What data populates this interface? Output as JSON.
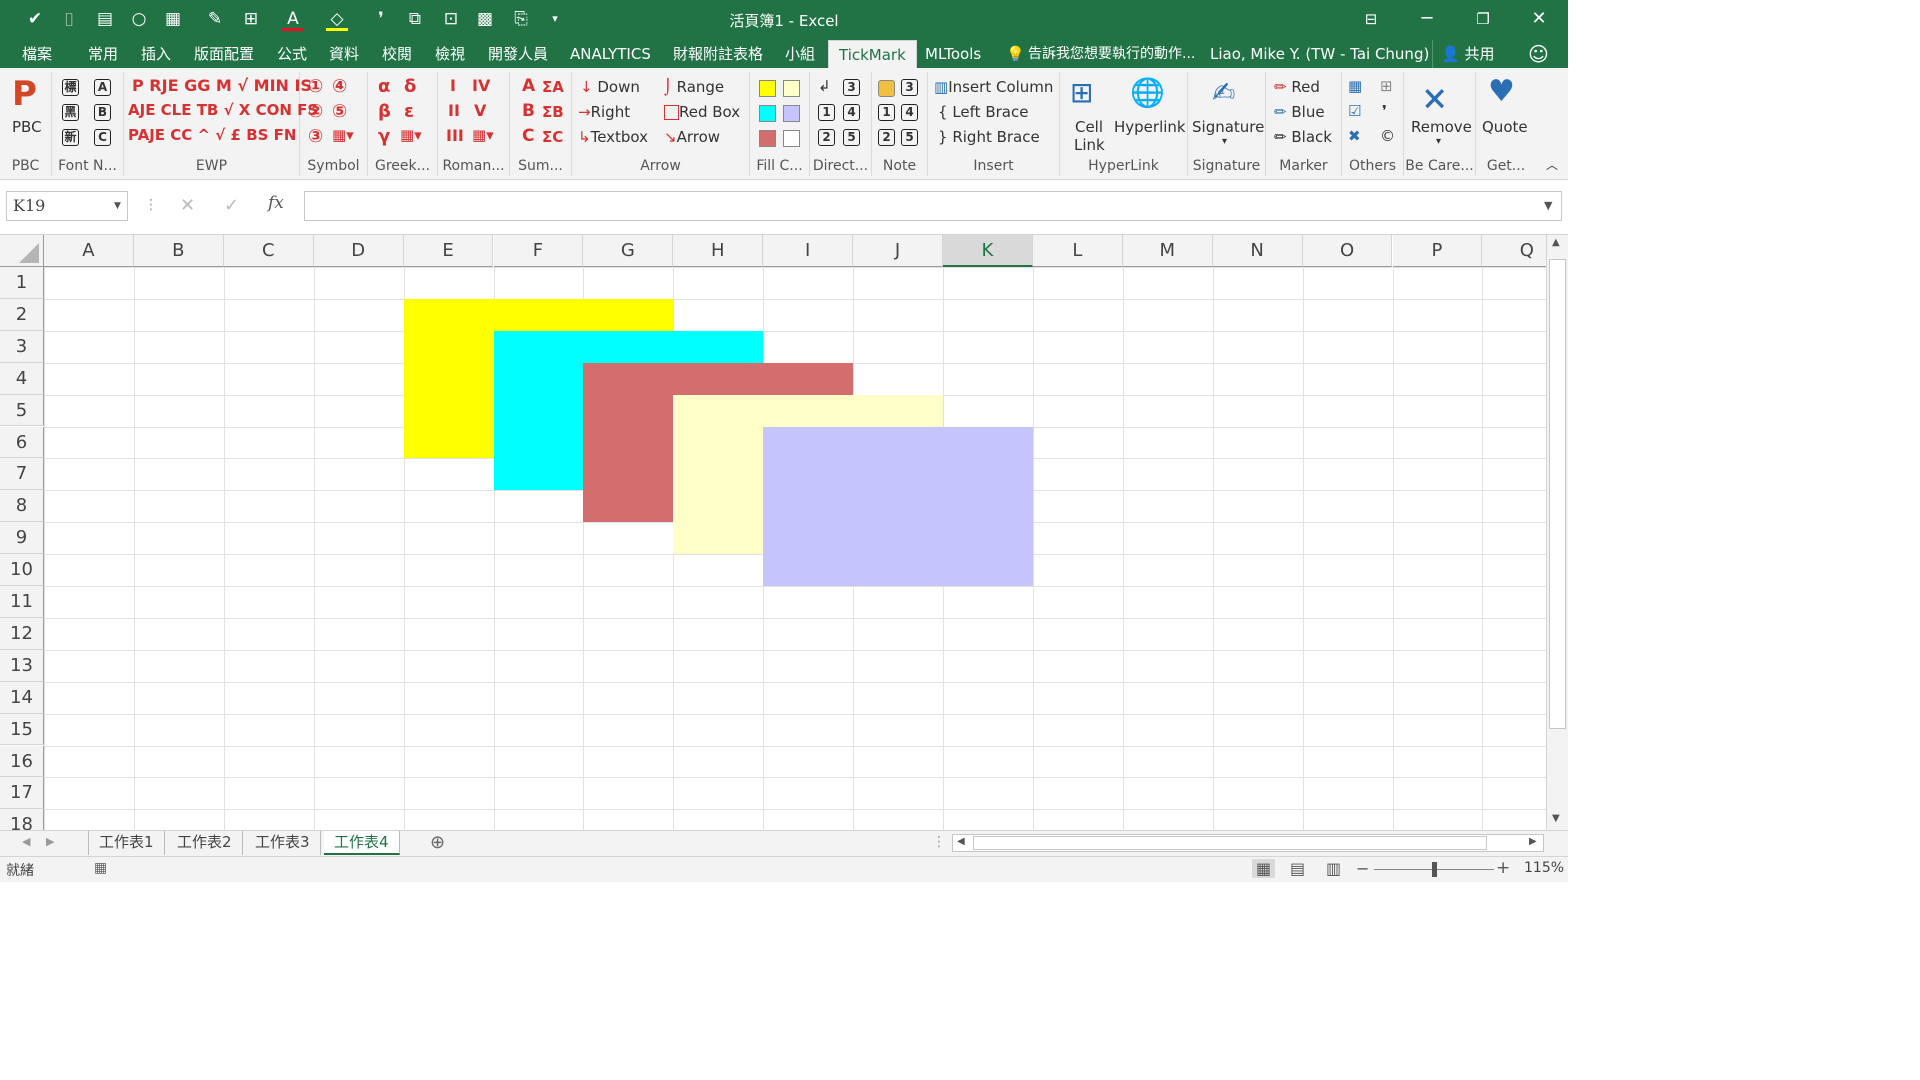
{
  "window": {
    "title": "活頁簿1 - Excel",
    "user": "Liao, Mike Y. (TW - Tai Chung)",
    "share": "共用",
    "tell_me": "告訴我您想要執行的動作..."
  },
  "tabs": [
    "檔案",
    "常用",
    "插入",
    "版面配置",
    "公式",
    "資料",
    "校閱",
    "檢視",
    "開發人員",
    "ANALYTICS",
    "財報附註表格",
    "小組",
    "TickMark",
    "MLTools"
  ],
  "active_tab": "TickMark",
  "ribbon": {
    "pbc": {
      "button": "PBC",
      "label": "PBC"
    },
    "fontn": {
      "label": "Font N...",
      "items": [
        "A",
        "B",
        "C"
      ]
    },
    "ewp": {
      "label": "EWP",
      "row1": "P RJE GG M √ MIN IS",
      "row2": "AJE CLE TB √ X CON FS",
      "row3": "PAJE CC ^ √ £ BS FN"
    },
    "symbol": {
      "label": "Symbol",
      "items": [
        "①",
        "②",
        "③",
        "④",
        "⑤"
      ]
    },
    "greek": {
      "label": "Greek...",
      "items": [
        "α",
        "β",
        "γ",
        "δ",
        "ε"
      ]
    },
    "roman": {
      "label": "Roman...",
      "items": [
        "I",
        "II",
        "III",
        "IV",
        "V"
      ]
    },
    "sum": {
      "label": "Sum...",
      "items": [
        "A",
        "B",
        "C",
        "ΣA",
        "ΣB",
        "ΣC"
      ]
    },
    "arrow": {
      "label": "Arrow",
      "items": [
        "Down",
        "Right",
        "Textbox",
        "Range",
        "Red Box",
        "Arrow"
      ]
    },
    "fill": {
      "label": "Fill C..."
    },
    "direct": {
      "label": "Direct..."
    },
    "note": {
      "label": "Note"
    },
    "insert": {
      "label": "Insert",
      "items": [
        "Insert Column",
        "Left Brace",
        "Right Brace"
      ]
    },
    "hyperlink": {
      "label": "HyperLink",
      "cell_link": "Cell Link",
      "hyperlink": "Hyperlink"
    },
    "signature": {
      "label": "Signature",
      "button": "Signature"
    },
    "marker": {
      "label": "Marker",
      "items": [
        "Red",
        "Blue",
        "Black"
      ]
    },
    "others": {
      "label": "Others"
    },
    "becare": {
      "label": "Be Care...",
      "button": "Remove"
    },
    "get": {
      "label": "Get...",
      "button": "Quote"
    }
  },
  "formula": {
    "namebox": "K19",
    "fx": "fx",
    "value": ""
  },
  "columns": [
    "A",
    "B",
    "C",
    "D",
    "E",
    "F",
    "G",
    "H",
    "I",
    "J",
    "K",
    "L",
    "M",
    "N",
    "O",
    "P",
    "Q"
  ],
  "selected_column": "K",
  "rows": [
    "1",
    "2",
    "3",
    "4",
    "5",
    "6",
    "7",
    "8",
    "9",
    "10",
    "11",
    "12",
    "13",
    "14",
    "15",
    "16",
    "17",
    "18"
  ],
  "shapes": [
    {
      "name": "yellow-rectangle",
      "color": "#FFFF00",
      "range": "E2:G6"
    },
    {
      "name": "cyan-rectangle",
      "color": "#00FFFF",
      "range": "F3:H7"
    },
    {
      "name": "red-rectangle",
      "color": "#D46E6E",
      "range": "G4:I8"
    },
    {
      "name": "light-yellow-rectangle",
      "color": "#FFFFC8",
      "range": "H5:J9"
    },
    {
      "name": "lavender-rectangle",
      "color": "#C5C5FC",
      "range": "I6:K10"
    }
  ],
  "sheets": [
    "工作表1",
    "工作表2",
    "工作表3",
    "工作表4"
  ],
  "active_sheet": "工作表4",
  "status": {
    "ready": "就緒",
    "zoom": "115%"
  }
}
